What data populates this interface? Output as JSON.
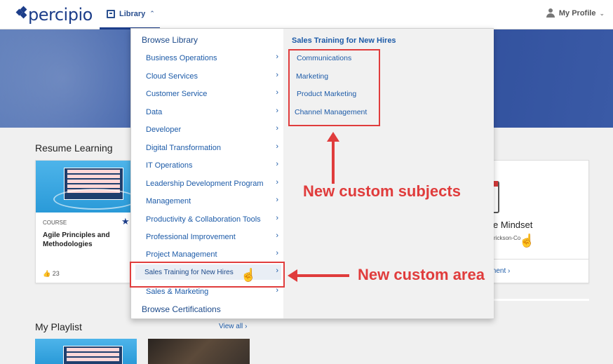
{
  "header": {
    "logo": "percipio",
    "library_label": "Library",
    "profile_label": "My Profile"
  },
  "sections": {
    "resume_title": "Resume Learning",
    "playlist_title": "My Playlist",
    "view_all": "View all"
  },
  "resume_card": {
    "type": "COURSE",
    "title": "Agile Principles and Methodologies",
    "likes": "23"
  },
  "partial_card": {
    "title_fragment": "gile Mindset",
    "author_fragment": "rickson-Co",
    "link_fragment": "ment"
  },
  "menu": {
    "browse_library": "Browse Library",
    "browse_certifications": "Browse Certifications",
    "items": [
      "Business Operations",
      "Cloud Services",
      "Customer Service",
      "Data",
      "Developer",
      "Digital Transformation",
      "IT Operations",
      "Leadership Development Program",
      "Management",
      "Productivity & Collaboration Tools",
      "Professional Improvement",
      "Project Management",
      "Sales Training for New Hires",
      "Sales & Marketing"
    ],
    "active_index": 12,
    "submenu_title": "Sales Training for New Hires",
    "submenu_items": [
      "Communications",
      "Marketing",
      "Product Marketing",
      "Channel Management"
    ]
  },
  "annotations": {
    "subjects": "New custom subjects",
    "area": "New custom area",
    "color": "#e03c3c"
  },
  "colors": {
    "brand": "#1d3e8a",
    "link": "#1d5ba8"
  }
}
